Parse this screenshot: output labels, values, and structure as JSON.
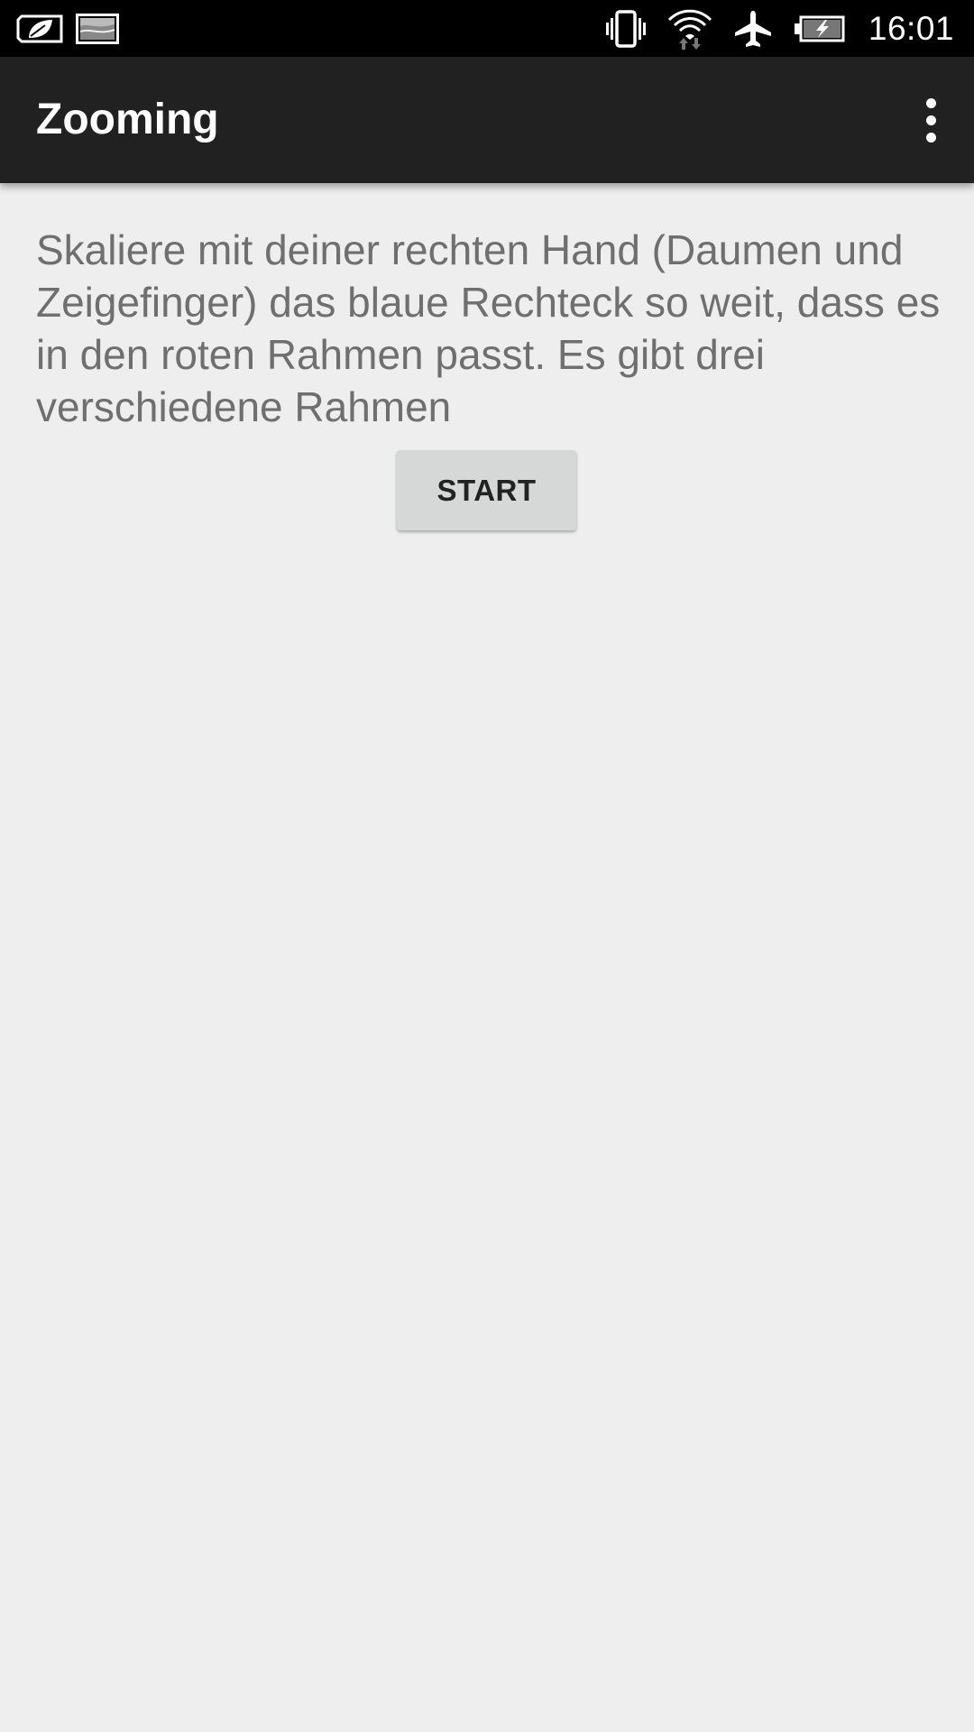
{
  "status_bar": {
    "time": "16:01",
    "icons": [
      "leaf-battery-saver-icon",
      "image-notification-icon",
      "vibrate-icon",
      "wifi-icon",
      "airplane-icon",
      "battery-charging-icon"
    ]
  },
  "app_bar": {
    "title": "Zooming",
    "overflow_icon": "more-vert-icon"
  },
  "main": {
    "instructions": "Skaliere mit deiner rechten Hand (Daumen und Zeigefinger) das blaue Rechteck so weit, dass es in den roten Rahmen passt. Es gibt drei verschiedene Rahmen",
    "start_label": "START"
  },
  "colors": {
    "status_bar": "#000000",
    "app_bar": "#212121",
    "background": "#eeeeee",
    "button": "#d6d7d7",
    "text": "#6f6f6f"
  }
}
